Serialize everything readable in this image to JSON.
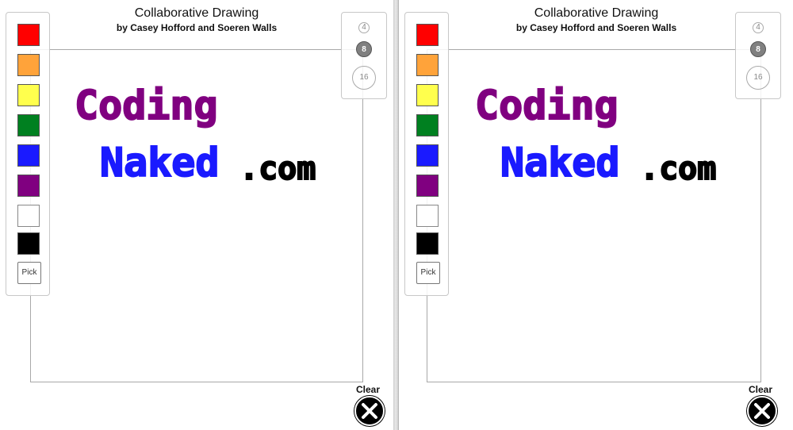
{
  "app": {
    "title": "Collaborative Drawing",
    "subtitle": "by Casey Hofford and Soeren Walls"
  },
  "palette": {
    "colors": [
      {
        "name": "red",
        "hex": "#ff0000"
      },
      {
        "name": "orange",
        "hex": "#ffa33a"
      },
      {
        "name": "yellow",
        "hex": "#ffff4d"
      },
      {
        "name": "green",
        "hex": "#008020"
      },
      {
        "name": "blue",
        "hex": "#1a1aff"
      },
      {
        "name": "purple",
        "hex": "#800080"
      },
      {
        "name": "white",
        "hex": "#ffffff"
      },
      {
        "name": "black",
        "hex": "#000000"
      }
    ],
    "pick_label": "Pick"
  },
  "brush_sizes": {
    "small": "4",
    "medium": "8",
    "large": "16",
    "selected": "8"
  },
  "clear": {
    "label": "Clear",
    "icon": "close-x-icon"
  },
  "drawing": {
    "line1": "Coding",
    "line2": "Naked",
    "line3": ".com",
    "line1_color": "#800080",
    "line2_color": "#1a1aff",
    "line3_color": "#000000"
  }
}
